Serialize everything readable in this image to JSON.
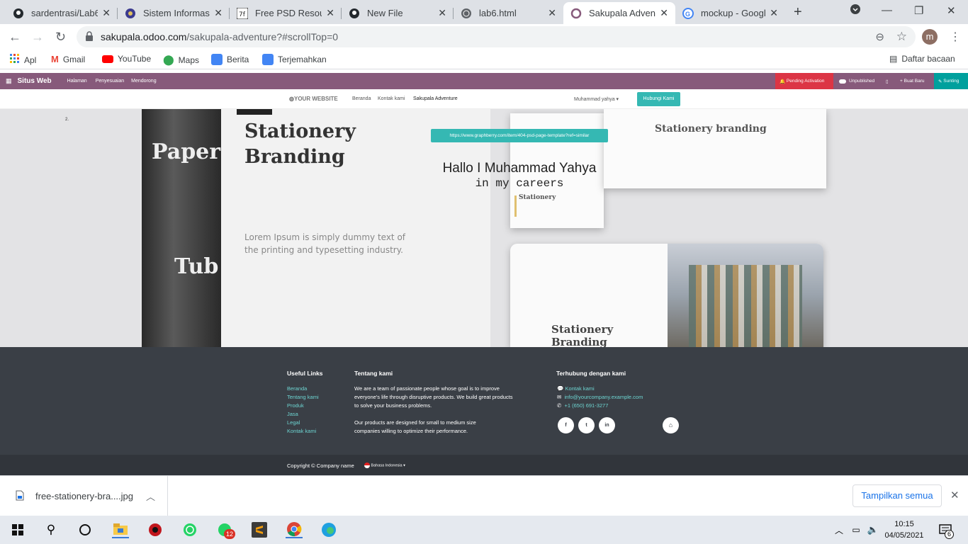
{
  "tabs": [
    {
      "title": "sardentrasi/Lab6",
      "icon": "github-icon"
    },
    {
      "title": "Sistem Informasi",
      "icon": "university-icon"
    },
    {
      "title": "Free PSD Resourc",
      "icon": "psd-icon"
    },
    {
      "title": "New File",
      "icon": "github-icon"
    },
    {
      "title": "lab6.html",
      "icon": "globe-icon"
    },
    {
      "title": "Sakupala Adventu",
      "icon": "odoo-icon"
    },
    {
      "title": "mockup - Google",
      "icon": "google-icon"
    }
  ],
  "address": {
    "host": "sakupala.odoo.com",
    "path": "/sakupala-adventure?#scrollTop=0"
  },
  "profile_initial": "m",
  "bookmarks": [
    "Apl",
    "Gmail",
    "YouTube",
    "Maps",
    "Berita",
    "Terjemahkan"
  ],
  "reading_list": "Daftar bacaan",
  "odoo_bar": {
    "brand": "Situs Web",
    "menu": [
      "Halaman",
      "Penyesuaian",
      "Mendorong"
    ],
    "pending": "Pending Activation",
    "unpublished": "Unpublished",
    "new": "Buat Baru",
    "edit": "Sunting"
  },
  "site_nav": {
    "logo": "YOUR WEBSITE",
    "links": [
      "Beranda",
      "Kontak kami",
      "Sakupala Adventure"
    ],
    "user": "Muhammad yahya",
    "cta": "Hubungi Kami"
  },
  "hero": {
    "small_mark": "2.",
    "url_label": "https://www.graphberry.com/item/404-psd-page-template?ref=similar",
    "headline": "Hallo I Muhammad Yahya",
    "subline": "in my careers",
    "mock_title_1": "Stationery",
    "mock_title_2": "Branding",
    "mock_body": "Lorem Ipsum is simply dummy text of the printing and typesetting industry.",
    "tube_a": "Paper",
    "tube_b": "Tub",
    "card_title": "Stationery branding",
    "card_small": "Stationery",
    "card_bottom_1": "Stationery",
    "card_bottom_2": "Branding"
  },
  "footer": {
    "useful_title": "Useful Links",
    "useful_links": [
      "Beranda",
      "Tentang kami",
      "Produk",
      "Jasa",
      "Legal",
      "Kontak kami"
    ],
    "about_title": "Tentang kami",
    "about_p1": "We are a team of passionate people whose goal is to improve everyone's life through disruptive products. We build great products to solve your business problems.",
    "about_p2": "Our products are designed for small to medium size companies willing to optimize their performance.",
    "contact_title": "Terhubung dengan kami",
    "contact_items": [
      "Kontak kami",
      "info@yourcompany.example.com",
      "+1 (650) 691-3277"
    ],
    "social": [
      "f",
      "t",
      "in"
    ],
    "copyright": "Copyright © Company name",
    "language": "Bahasa Indonesia"
  },
  "download": {
    "file": "free-stationery-bra....jpg",
    "show_all": "Tampilkan semua"
  },
  "taskbar": {
    "time": "10:15",
    "date": "04/05/2021",
    "whatsapp_badge": "12",
    "notif_count": "6"
  }
}
